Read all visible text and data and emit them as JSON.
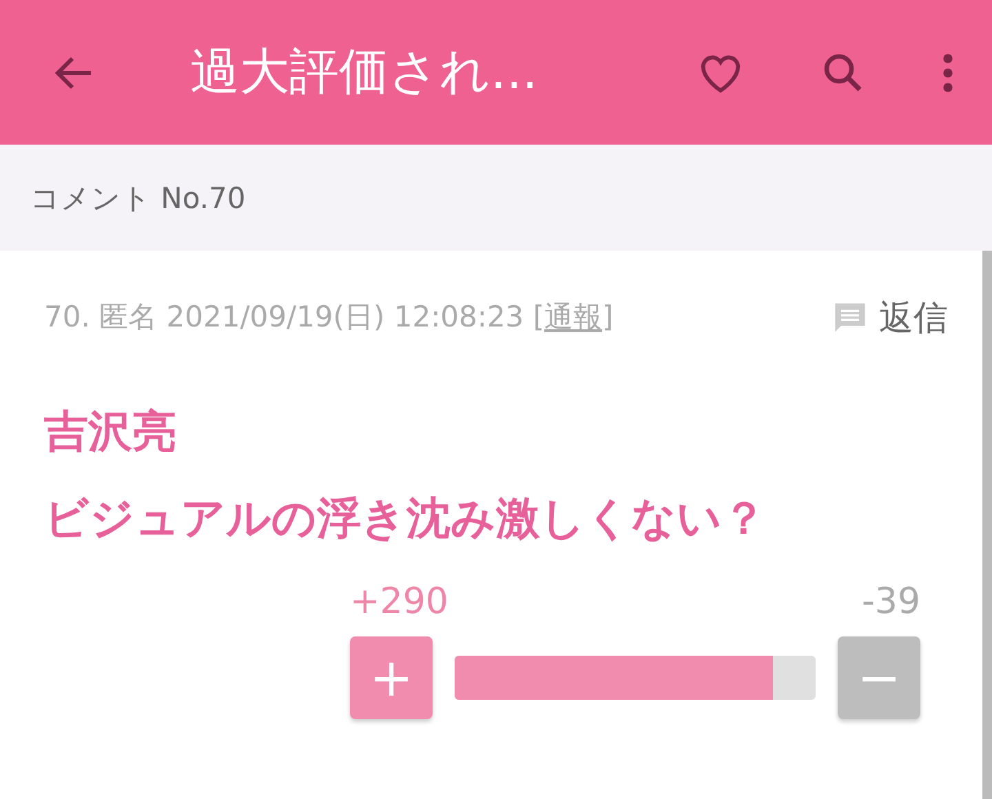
{
  "app_bar": {
    "title": "過大評価され..."
  },
  "section_header": {
    "label": "コメント No.70"
  },
  "comment": {
    "meta_prefix": "70. 匿名 2021/09/19(日) 12:08:23 [",
    "report_link": "通報",
    "meta_suffix": "]",
    "reply_label": "返信",
    "body_lines": [
      "吉沢亮",
      "ビジュアルの浮き沈み激しくない？"
    ],
    "votes": {
      "plus_count": "+290",
      "minus_count": "-39",
      "plus_label": "+",
      "minus_label": "−",
      "level": 0.88
    }
  }
}
